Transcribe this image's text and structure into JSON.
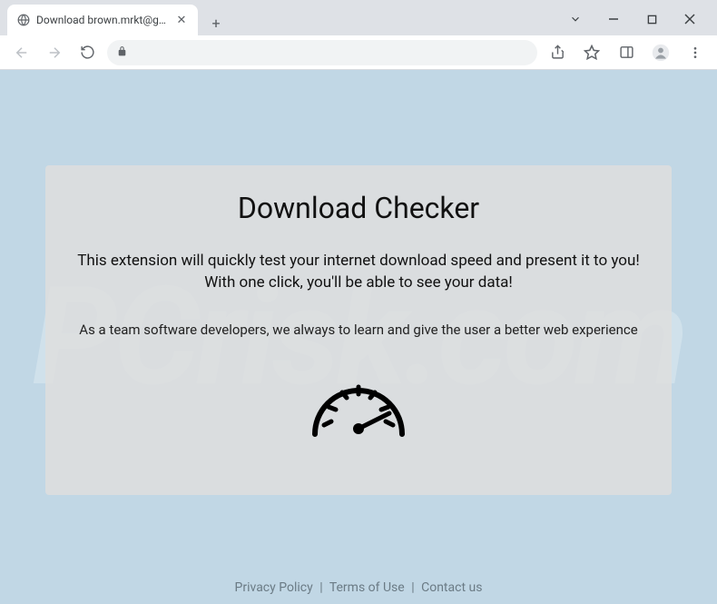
{
  "browser": {
    "tab_title": "Download brown.mrkt@gmail.co"
  },
  "page": {
    "title": "Download Checker",
    "subtitle1_line1": "This extension will quickly test your internet download speed and present it to you!",
    "subtitle1_line2": "With one click, you'll be able to see your data!",
    "subtitle2": "As a team software developers, we always to learn and give the user a better web experience"
  },
  "footer": {
    "privacy": "Privacy Policy",
    "terms": "Terms of Use",
    "contact": "Contact us",
    "sep": "|"
  },
  "watermark": "PCrisk.com"
}
